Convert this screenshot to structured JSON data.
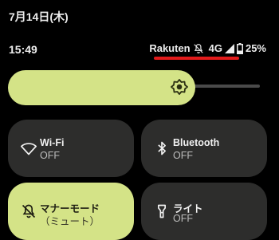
{
  "header": {
    "date": "7月14日(木)",
    "time": "15:49"
  },
  "status_bar": {
    "carrier": "Rakuten",
    "network": "4G",
    "battery": "25%",
    "icons": [
      "mute-icon",
      "signal-icon",
      "battery-icon"
    ],
    "highlight_color": "#e21b1b"
  },
  "brightness": {
    "level": 0.7,
    "icon": "brightness-icon"
  },
  "tiles": [
    {
      "label": "Wi-Fi",
      "sub": "OFF",
      "icon": "wifi-icon",
      "state": "off"
    },
    {
      "label": "Bluetooth",
      "sub": "OFF",
      "icon": "bluetooth-icon",
      "state": "off"
    },
    {
      "label": "マナーモード",
      "sub": "（ミュート）",
      "icon": "mute-icon",
      "state": "on"
    },
    {
      "label": "ライト",
      "sub": "OFF",
      "icon": "flashlight-icon",
      "state": "off"
    }
  ],
  "colors": {
    "accent": "#d4e387",
    "tile_off": "#2d2d2c",
    "background": "#000000"
  }
}
